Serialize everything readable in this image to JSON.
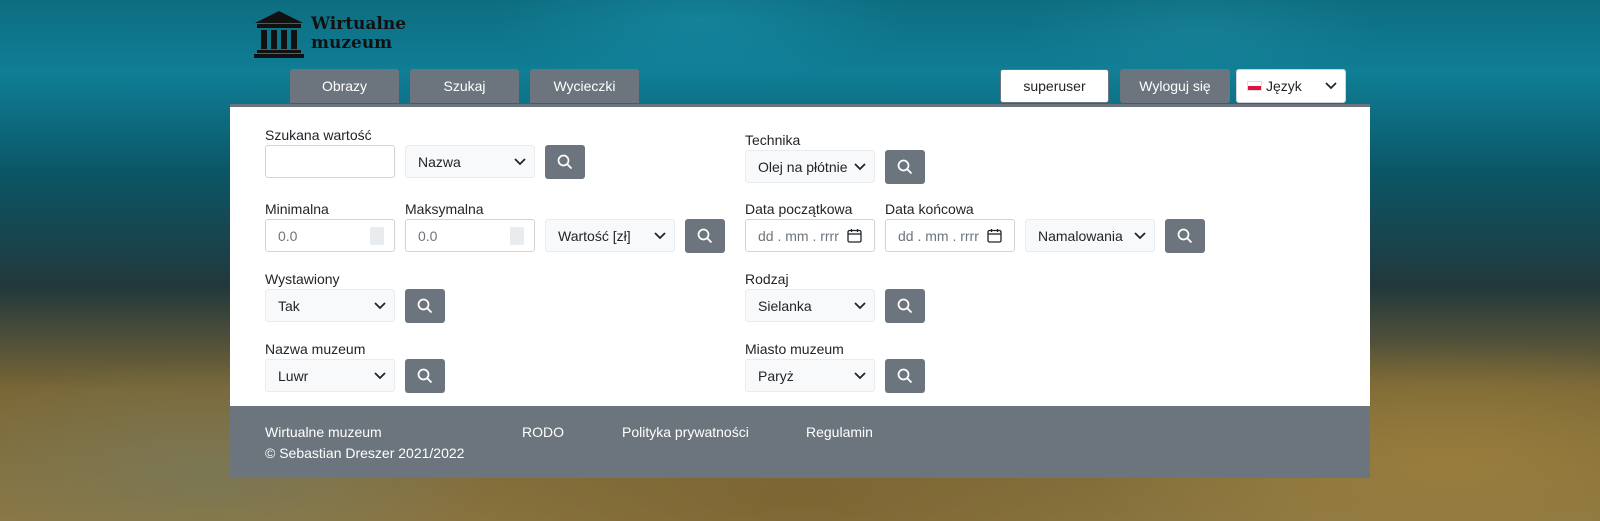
{
  "brand": {
    "line1": "Wirtualne",
    "line2": "muzeum"
  },
  "nav": {
    "tabs": [
      "Obrazy",
      "Szukaj",
      "Wycieczki"
    ]
  },
  "user": {
    "username": "superuser",
    "logout": "Wyloguj się",
    "language": "Język"
  },
  "search": {
    "value_label": "Szukana wartość",
    "value_input": "",
    "value_field_select": "Nazwa",
    "technique_label": "Technika",
    "technique_select": "Olej na płótnie",
    "min_label": "Minimalna",
    "min_value": "0.0",
    "max_label": "Maksymalna",
    "max_value": "0.0",
    "value_unit_select": "Wartość [zł]",
    "start_date_label": "Data początkowa",
    "start_date_placeholder": "dd . mm . rrrr",
    "end_date_label": "Data końcowa",
    "end_date_placeholder": "dd . mm . rrrr",
    "date_type_select": "Namalowania",
    "exhibited_label": "Wystawiony",
    "exhibited_select": "Tak",
    "genre_label": "Rodzaj",
    "genre_select": "Sielanka",
    "museum_name_label": "Nazwa muzeum",
    "museum_name_select": "Luwr",
    "museum_city_label": "Miasto muzeum",
    "museum_city_select": "Paryż"
  },
  "footer": {
    "name": "Wirtualne muzeum",
    "copyright": "© Sebastian Dreszer 2021/2022",
    "links": [
      "RODO",
      "Polityka prywatności",
      "Regulamin"
    ]
  },
  "colors": {
    "button_gray": "#6c757d",
    "panel_white": "#ffffff"
  }
}
